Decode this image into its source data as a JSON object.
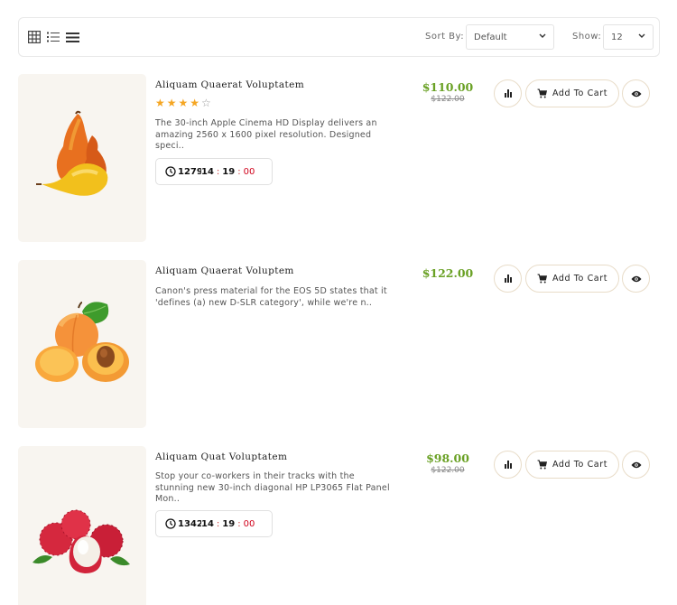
{
  "toolbar": {
    "view_icons": [
      "grid-view-icon",
      "list-view-icon",
      "compact-list-icon"
    ],
    "sort_label": "Sort By:",
    "sort_value": "Default",
    "show_label": "Show:",
    "show_value": "12"
  },
  "products": [
    {
      "title": "Aliquam Quaerat Voluptatem",
      "rating": 4,
      "rating_max": 5,
      "description": "The 30-inch Apple Cinema HD Display delivers an amazing 2560 x 1600 pixel resolution. Designed speci..",
      "price": "$110.00",
      "old_price": "$122.00",
      "timer": {
        "days": "1279",
        "hours": "14",
        "minutes": "19",
        "seconds": "00"
      },
      "image": "pears",
      "cart_label": "Add To Cart"
    },
    {
      "title": "Aliquam Quaerat Voluptem",
      "description": "Canon's press material for the EOS 5D states that it 'defines (a) new D-SLR category', while we're n..",
      "price": "$122.00",
      "image": "apricots",
      "cart_label": "Add To Cart"
    },
    {
      "title": "Aliquam Quat Voluptatem",
      "description": "Stop your co-workers in their tracks with the stunning new 30-inch diagonal HP LP3065 Flat Panel Mon..",
      "price": "$98.00",
      "old_price": "$122.00",
      "timer": {
        "days": "1342",
        "hours": "14",
        "minutes": "19",
        "seconds": "00"
      },
      "image": "lychees",
      "cart_label": "Add To Cart"
    }
  ],
  "colors": {
    "price": "#6aa125",
    "star": "#f5a623",
    "seconds": "#d0021b",
    "thumb_bg": "#f8f5f0"
  }
}
